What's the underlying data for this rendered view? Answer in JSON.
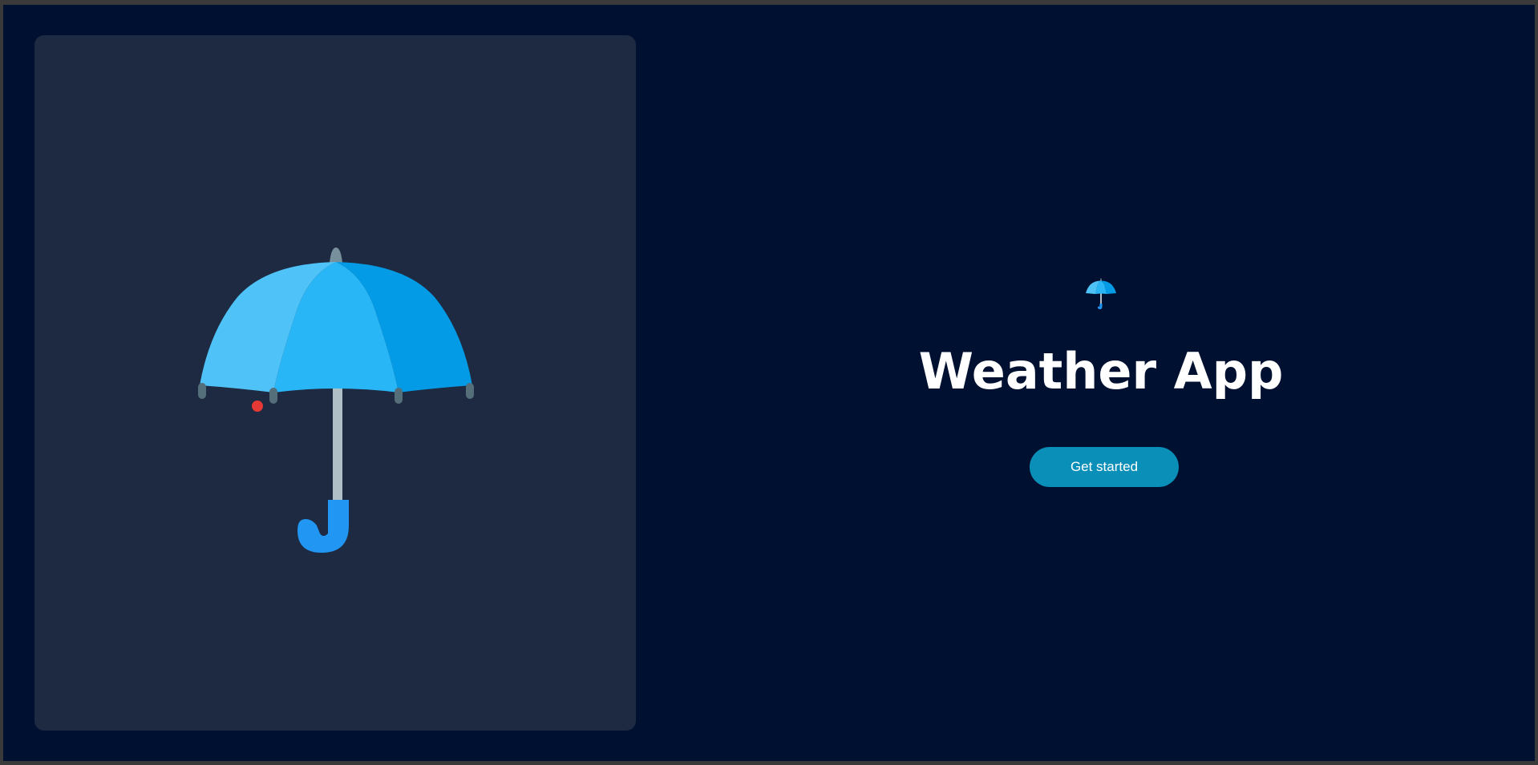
{
  "app": {
    "title": "Weather App",
    "cta_label": "Get started"
  },
  "icons": {
    "hero": "umbrella-icon",
    "brand": "umbrella-icon"
  },
  "colors": {
    "background": "#001030",
    "panel": "#1e2a42",
    "button": "#0a8fb8",
    "umbrella_light": "#4fc3f7",
    "umbrella_mid": "#29b6f6",
    "umbrella_dark": "#039be5",
    "handle": "#2196f3",
    "marker": "#e53935"
  }
}
